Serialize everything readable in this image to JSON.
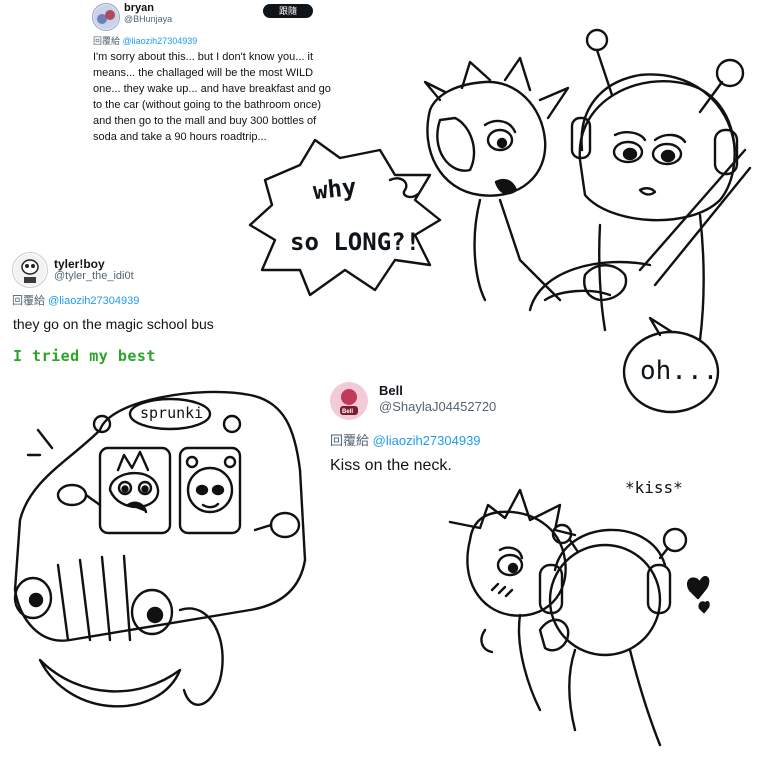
{
  "tweets": [
    {
      "name": "bryan",
      "handle": "@BHunjaya",
      "follow_label": "跟隨",
      "reply_prefix": "回覆給",
      "reply_to": "@liaozih27304939",
      "text": "I'm sorry about this... but I don't know you... it means... the challaged will be the most WILD one... they wake up... and have breakfast and go to the car (without going to the bathroom once) and then go to the mall and buy 300 bottles of soda and take a 90 hours roadtrip..."
    },
    {
      "name": "tyler!boy",
      "handle": "@tyler_the_idi0t",
      "reply_prefix": "回覆給",
      "reply_to": "@liaozih27304939",
      "text": "they go on the magic school bus"
    },
    {
      "name": "Bell",
      "handle": "@ShaylaJ04452720",
      "avatar_text": "Bell",
      "reply_prefix": "回覆給",
      "reply_to": "@liaozih27304939",
      "text": "Kiss on the neck."
    }
  ],
  "captions": {
    "tried_best": "I tried my best",
    "tried_best_color": "#2aa52a"
  },
  "comic": {
    "speech_why": "why",
    "speech_long": "so LONG?!",
    "speech_oh": "oh...",
    "bus_sign": "sprunki",
    "kiss_sfx": "*kiss*"
  }
}
